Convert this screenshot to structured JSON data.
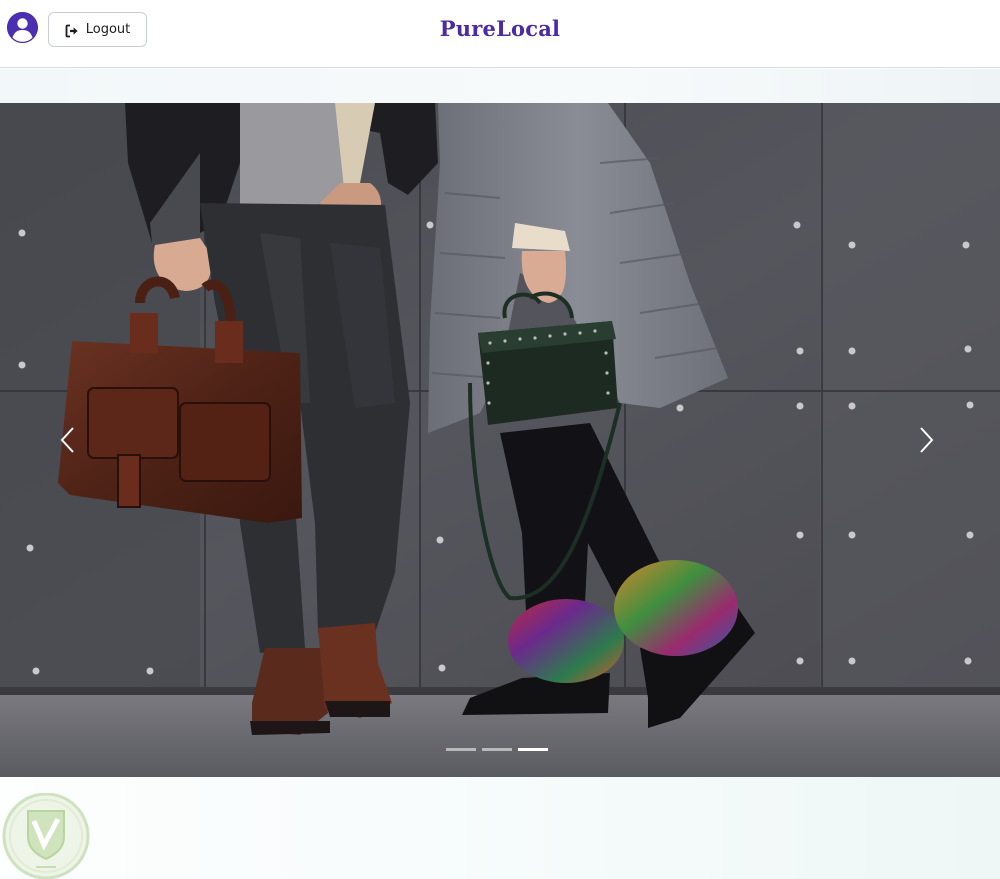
{
  "header": {
    "brand": "PureLocal",
    "logout_label": "Logout",
    "icons": {
      "avatar": "user-circle-icon",
      "logout": "sign-out-icon"
    }
  },
  "carousel": {
    "slide_count": 3,
    "active_index": 2,
    "icons": {
      "prev": "chevron-left-icon",
      "next": "chevron-right-icon"
    }
  },
  "colors": {
    "brand": "#4b2aa6",
    "avatar": "#4b2fb0",
    "page_bg": "#fbfdfe"
  }
}
